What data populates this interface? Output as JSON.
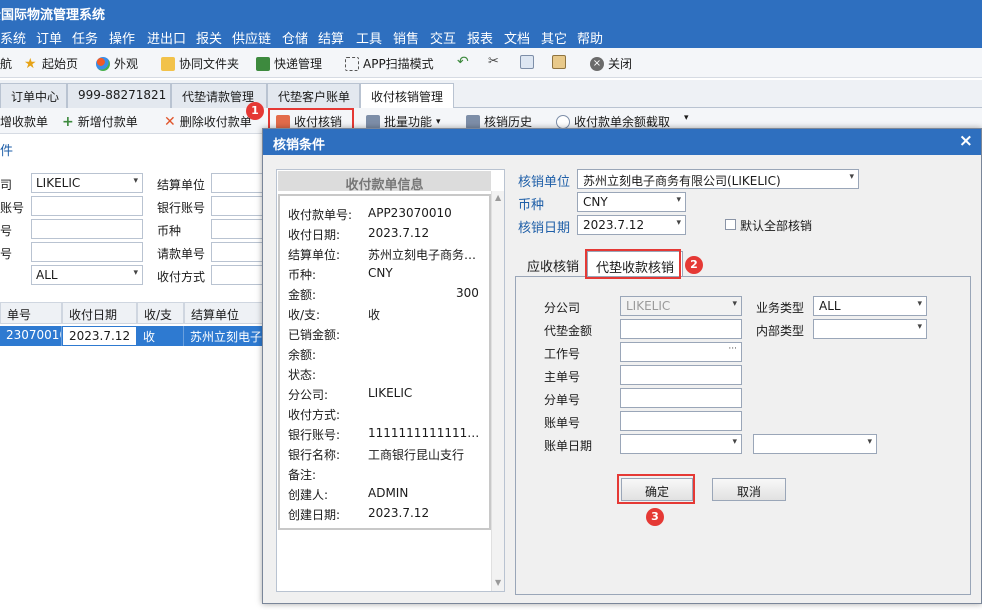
{
  "app": {
    "title": "云国际物流管理系统"
  },
  "menu": [
    "系统",
    "订单",
    "任务",
    "操作",
    "进出口",
    "报关",
    "供应链",
    "仓储",
    "结算",
    "工具",
    "销售",
    "交互",
    "报表",
    "文档",
    "其它",
    "帮助"
  ],
  "toolbar": {
    "nav_label": "航",
    "home_label": "起始页",
    "appearance_label": "外观",
    "shared_folder_label": "协同文件夹",
    "express_label": "快递管理",
    "app_scan_label": "APP扫描模式",
    "close_label": "关闭"
  },
  "tabs": [
    "订单中心",
    "999-88271821",
    "代垫请款管理",
    "代垫客户账单",
    "收付核销管理"
  ],
  "subtoolbar": {
    "add_receipt": "增收款单",
    "add_payment": "新增付款单",
    "delete_payment": "删除收付款单",
    "receipt_verify": "收付核销",
    "batch": "批量功能",
    "history": "核销历史",
    "balance": "收付款单余额截取"
  },
  "conditions": {
    "title": "件",
    "company_value": "LIKELIC",
    "settlement_unit_label": "结算单位",
    "bank_account_label": "银行账号",
    "currency_label": "币种",
    "request_no_label": "请款单号",
    "payment_method_label": "收付方式",
    "left_label_1": "司",
    "left_label_2": "账号",
    "left_label_3": "号",
    "left_label_4": "号",
    "type_value": "ALL"
  },
  "grid": {
    "headers": [
      "单号",
      "收付日期",
      "收/支",
      "结算单位"
    ],
    "row": [
      "23070010",
      "2023.7.12",
      "收",
      "苏州立刻电子"
    ]
  },
  "dialog": {
    "title": "核销条件",
    "close_glyph": "×",
    "info_header": "收付款单信息",
    "info_rows": [
      {
        "label": "收付款单号:",
        "value": "APP23070010"
      },
      {
        "label": "收付日期:",
        "value": "2023.7.12"
      },
      {
        "label": "结算单位:",
        "value": "苏州立刻电子商务…"
      },
      {
        "label": "币种:",
        "value": "CNY"
      },
      {
        "label": "金额:",
        "value": "300"
      },
      {
        "label": "收/支:",
        "value": "收"
      },
      {
        "label": "已销金额:",
        "value": ""
      },
      {
        "label": "余额:",
        "value": ""
      },
      {
        "label": "状态:",
        "value": ""
      },
      {
        "label": "分公司:",
        "value": "LIKELIC"
      },
      {
        "label": "收付方式:",
        "value": ""
      },
      {
        "label": "银行账号:",
        "value": "1111111111111…"
      },
      {
        "label": "银行名称:",
        "value": "工商银行昆山支行"
      },
      {
        "label": "备注:",
        "value": ""
      },
      {
        "label": "创建人:",
        "value": "ADMIN"
      },
      {
        "label": "创建日期:",
        "value": "2023.7.12"
      }
    ],
    "verify_unit_label": "核销单位",
    "verify_unit_value": "苏州立刻电子商务有限公司(LIKELIC)",
    "currency_label": "币种",
    "currency_value": "CNY",
    "verify_date_label": "核销日期",
    "verify_date_value": "2023.7.12",
    "default_all_label": "默认全部核销",
    "tab_receivable": "应收核销",
    "tab_advance": "代垫收款核销",
    "form": {
      "branch_label": "分公司",
      "branch_value": "LIKELIC",
      "biz_type_label": "业务类型",
      "biz_type_value": "ALL",
      "advance_amount_label": "代垫金额",
      "internal_type_label": "内部类型",
      "job_no_label": "工作号",
      "job_no_value": "···",
      "master_no_label": "主单号",
      "house_no_label": "分单号",
      "bill_no_label": "账单号",
      "bill_date_label": "账单日期"
    },
    "confirm_label": "确定",
    "cancel_label": "取消"
  },
  "annotations": [
    "1",
    "2",
    "3"
  ],
  "colors": {
    "titlebar": "#2e6fbf",
    "highlight": "#e53935",
    "selection": "#2e7ad1"
  }
}
